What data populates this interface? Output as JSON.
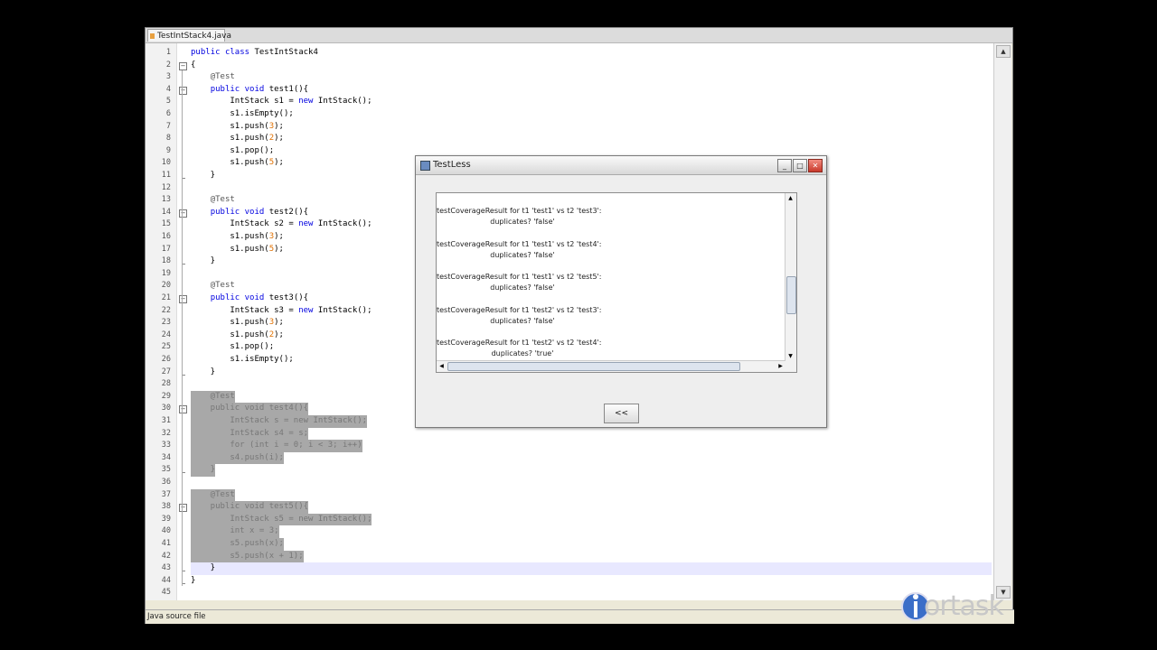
{
  "editor": {
    "tab_title": "TestIntStack4.java",
    "status_text": "Java source file",
    "lines": [
      {
        "n": "1",
        "text": "public class TestIntStack4"
      },
      {
        "n": "2",
        "text": "{"
      },
      {
        "n": "3",
        "text": "    @Test"
      },
      {
        "n": "4",
        "text": "    public void test1(){"
      },
      {
        "n": "5",
        "text": "        IntStack s1 = new IntStack();"
      },
      {
        "n": "6",
        "text": "        s1.isEmpty();"
      },
      {
        "n": "7",
        "text": "        s1.push(3);"
      },
      {
        "n": "8",
        "text": "        s1.push(2);"
      },
      {
        "n": "9",
        "text": "        s1.pop();"
      },
      {
        "n": "10",
        "text": "        s1.push(5);"
      },
      {
        "n": "11",
        "text": "    }"
      },
      {
        "n": "12",
        "text": ""
      },
      {
        "n": "13",
        "text": "    @Test"
      },
      {
        "n": "14",
        "text": "    public void test2(){"
      },
      {
        "n": "15",
        "text": "        IntStack s2 = new IntStack();"
      },
      {
        "n": "16",
        "text": "        s1.push(3);"
      },
      {
        "n": "17",
        "text": "        s1.push(5);"
      },
      {
        "n": "18",
        "text": "    }"
      },
      {
        "n": "19",
        "text": ""
      },
      {
        "n": "20",
        "text": "    @Test"
      },
      {
        "n": "21",
        "text": "    public void test3(){"
      },
      {
        "n": "22",
        "text": "        IntStack s3 = new IntStack();"
      },
      {
        "n": "23",
        "text": "        s1.push(3);"
      },
      {
        "n": "24",
        "text": "        s1.push(2);"
      },
      {
        "n": "25",
        "text": "        s1.pop();"
      },
      {
        "n": "26",
        "text": "        s1.isEmpty();"
      },
      {
        "n": "27",
        "text": "    }"
      },
      {
        "n": "28",
        "text": ""
      },
      {
        "n": "29",
        "text": "    @Test"
      },
      {
        "n": "30",
        "text": "    public void test4(){"
      },
      {
        "n": "31",
        "text": "        IntStack s = new IntStack();"
      },
      {
        "n": "32",
        "text": "        IntStack s4 = s;"
      },
      {
        "n": "33",
        "text": "        for (int i = 0; i < 3; i++)"
      },
      {
        "n": "34",
        "text": "        s4.push(i);"
      },
      {
        "n": "35",
        "text": "    }"
      },
      {
        "n": "36",
        "text": ""
      },
      {
        "n": "37",
        "text": "    @Test"
      },
      {
        "n": "38",
        "text": "    public void test5(){"
      },
      {
        "n": "39",
        "text": "        IntStack s5 = new IntStack();"
      },
      {
        "n": "40",
        "text": "        int x = 3;"
      },
      {
        "n": "41",
        "text": "        s5.push(x);"
      },
      {
        "n": "42",
        "text": "        s5.push(x + 1);"
      },
      {
        "n": "43",
        "text": "    }"
      },
      {
        "n": "44",
        "text": "}"
      },
      {
        "n": "45",
        "text": ""
      }
    ]
  },
  "dialog": {
    "title": "TestLess",
    "back_label": "<<",
    "results": [
      {
        "line1": "testCoverageResult for t1 'test1' vs t2 'test3':",
        "line2": "duplicates? 'false'"
      },
      {
        "line1": "testCoverageResult for t1 'test1' vs t2 'test4':",
        "line2": "duplicates? 'false'"
      },
      {
        "line1": "testCoverageResult for t1 'test1' vs t2 'test5':",
        "line2": "duplicates? 'false'"
      },
      {
        "line1": "testCoverageResult for t1 'test2' vs t2 'test3':",
        "line2": "duplicates? 'false'"
      },
      {
        "line1": "testCoverageResult for t1 'test2' vs t2 'test4':",
        "line2": "duplicates? 'true'"
      }
    ]
  },
  "logo": {
    "text": "ortask"
  },
  "colors": {
    "keyword": "#0000e0",
    "number": "#e07000",
    "selection": "#a8a8a8"
  }
}
